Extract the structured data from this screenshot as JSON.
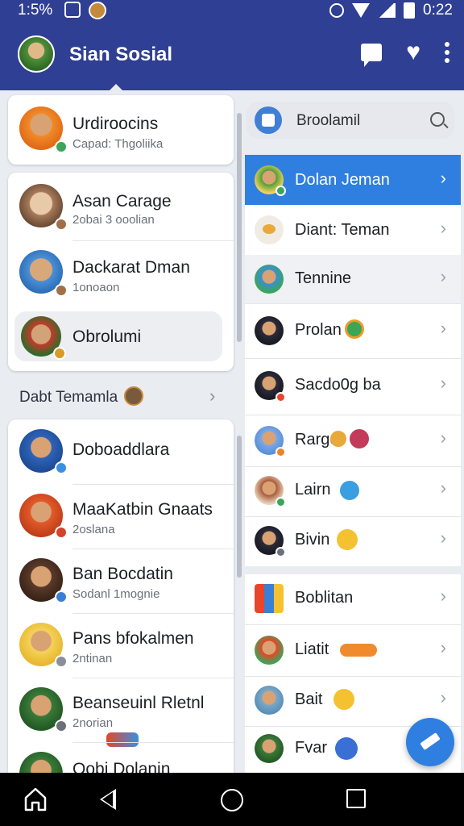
{
  "status_bar": {
    "time_left": "1:5%",
    "time_right": "0:22"
  },
  "app_bar": {
    "title": "Sian Sosial"
  },
  "left_panel": {
    "top_card": {
      "name": "Urdiroocins",
      "subtitle": "Capad: Thgoliika"
    },
    "group_card": [
      {
        "name": "Asan Carage",
        "subtitle": "2obai 3 ooolian"
      },
      {
        "name": "Dackarat Dman",
        "subtitle": "1onoaon"
      },
      {
        "name": "Obrolumi",
        "subtitle": ""
      }
    ],
    "section_header": "Dabt Temamla",
    "list": [
      {
        "name": "Doboaddlara",
        "subtitle": ""
      },
      {
        "name": "MaaKatbin Gnaats",
        "subtitle": "2oslana"
      },
      {
        "name": "Ban Bocdatin",
        "subtitle": "Sodanl 1mognie"
      },
      {
        "name": "Pans bfokalmen",
        "subtitle": "2ntinan"
      },
      {
        "name": "Beanseuinl Rletnl",
        "subtitle": "2norian"
      },
      {
        "name": "Oobi Dolanin",
        "subtitle": ""
      }
    ]
  },
  "right_panel": {
    "search": {
      "value": "Broolamil"
    },
    "items": [
      {
        "name": "Dolan Jeman",
        "selected": true
      },
      {
        "name": "Diant: Teman"
      },
      {
        "name": "Tennine"
      },
      {
        "name": "Prolan"
      },
      {
        "name": "Sacdo0g ba"
      },
      {
        "name": "Rargo"
      },
      {
        "name": "Lairn"
      },
      {
        "name": "Bivin"
      },
      {
        "name": "Boblitan"
      },
      {
        "name": "Liatit"
      },
      {
        "name": "Bait"
      },
      {
        "name": "Fvar"
      }
    ]
  },
  "colors": {
    "app_bar": "#2f3f93",
    "selected": "#2f7fe0",
    "fab": "#2f7fe0"
  }
}
